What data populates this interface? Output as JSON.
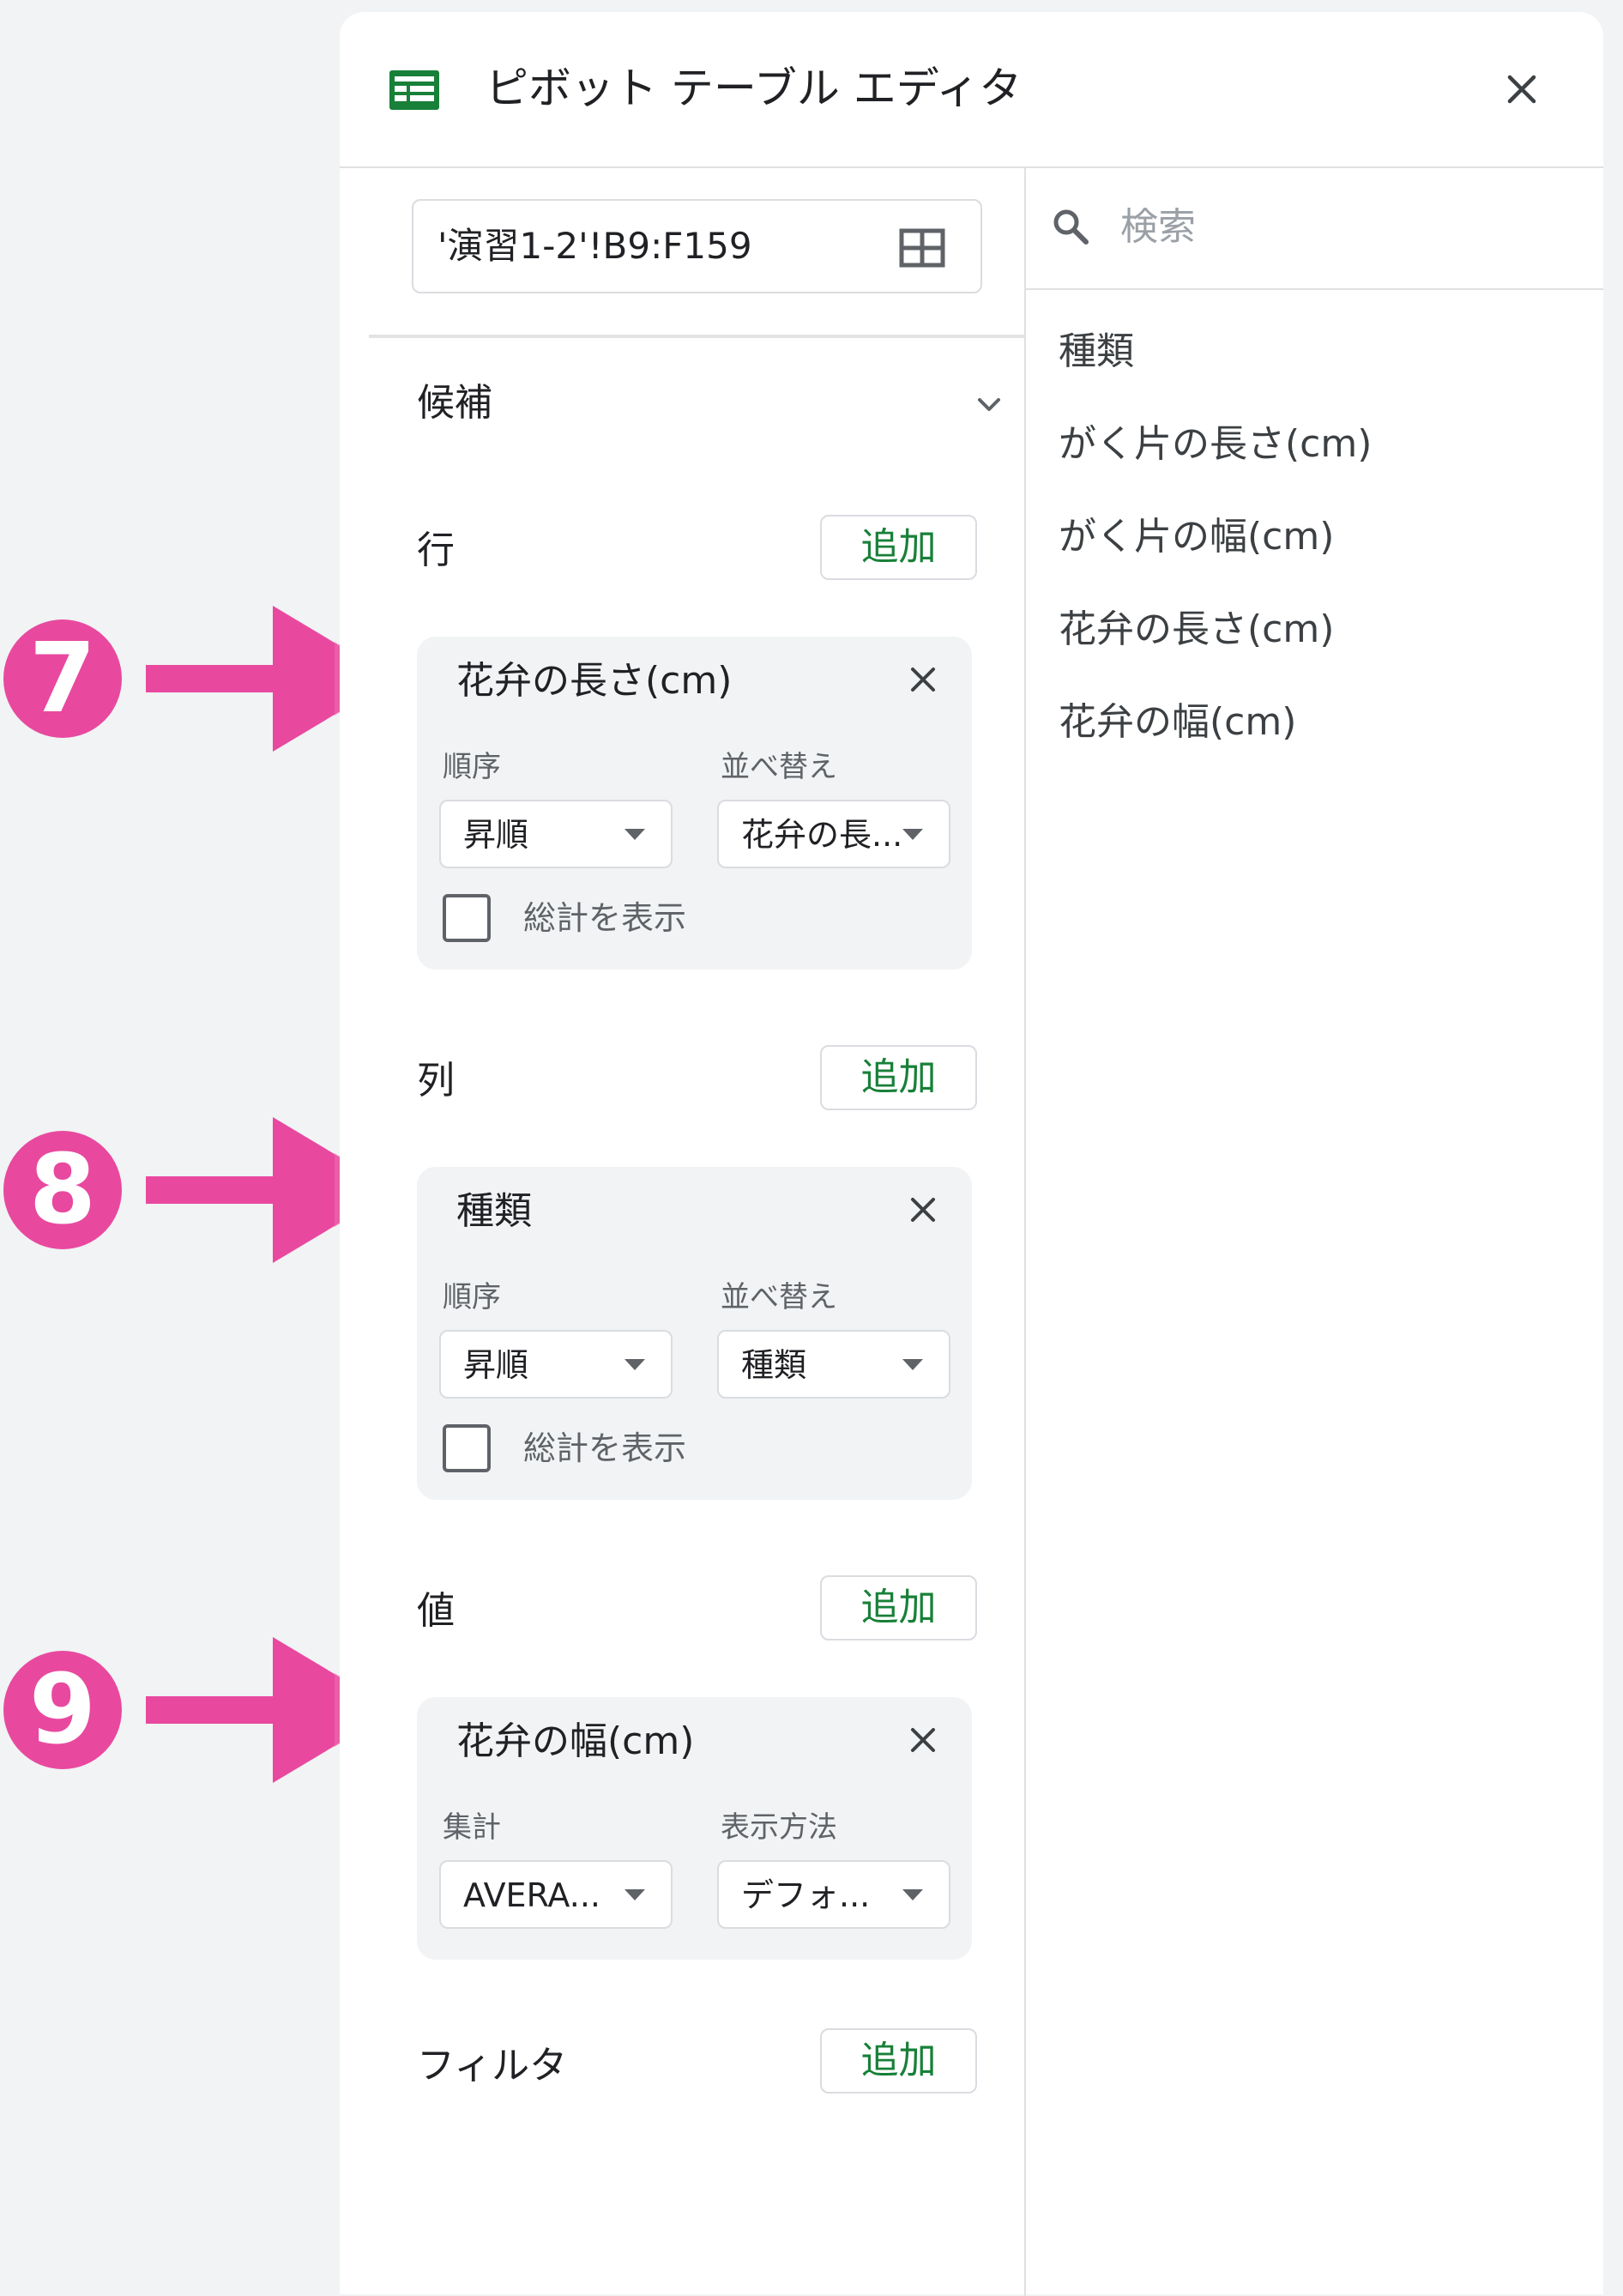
{
  "header": {
    "title": "ピボット テーブル エディタ",
    "sheets_icon": "sheets-icon",
    "close_icon": "close-icon"
  },
  "range": {
    "value": "'演習1-2'!B9:F159",
    "icon": "grid-icon"
  },
  "suggestions": {
    "label": "候補",
    "icon": "chevron-down-icon"
  },
  "sections": {
    "rows": {
      "label": "行",
      "add_label": "追加",
      "card": {
        "title": "花弁の長さ(cm)",
        "left_label": "順序",
        "left_value": "昇順",
        "right_label": "並べ替え",
        "right_value": "花弁の長...",
        "checkbox_label": "総計を表示",
        "checkbox_checked": false
      }
    },
    "columns": {
      "label": "列",
      "add_label": "追加",
      "card": {
        "title": "種類",
        "left_label": "順序",
        "left_value": "昇順",
        "right_label": "並べ替え",
        "right_value": "種類",
        "checkbox_label": "総計を表示",
        "checkbox_checked": false
      }
    },
    "values": {
      "label": "値",
      "add_label": "追加",
      "card": {
        "title": "花弁の幅(cm)",
        "left_label": "集計",
        "left_value": "AVERA...",
        "right_label": "表示方法",
        "right_value": "デフォ..."
      }
    },
    "filters": {
      "label": "フィルタ",
      "add_label": "追加"
    }
  },
  "search": {
    "placeholder": "検索",
    "icon": "search-icon"
  },
  "fields": [
    "種類",
    "がく片の長さ(cm)",
    "がく片の幅(cm)",
    "花弁の長さ(cm)",
    "花弁の幅(cm)"
  ],
  "annotations": [
    {
      "number": "7",
      "color": "#e8499f"
    },
    {
      "number": "8",
      "color": "#e8499f"
    },
    {
      "number": "9",
      "color": "#e8499f"
    }
  ],
  "colors": {
    "accent_green": "#188038",
    "sheets_green": "#188038",
    "annotation_pink": "#e8499f",
    "card_background": "#f1f3f4"
  }
}
